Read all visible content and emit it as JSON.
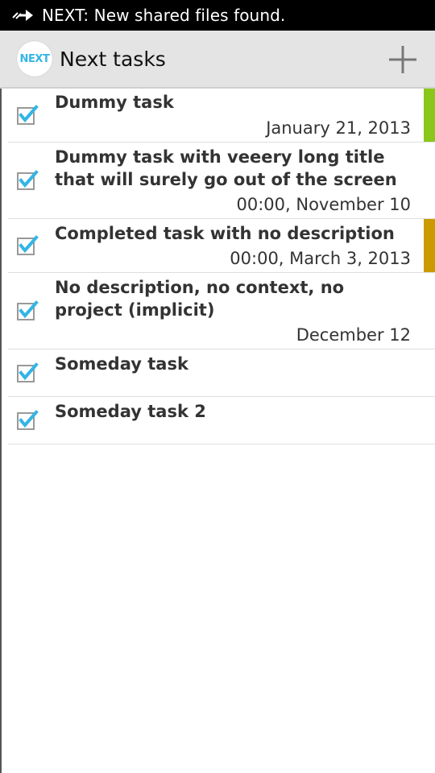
{
  "status_bar": {
    "notification_icon": "forward-arrow-icon",
    "text": "NEXT: New shared files found."
  },
  "action_bar": {
    "logo_text": "NEXT",
    "title": "Next tasks",
    "add_icon": "plus-icon"
  },
  "tasks": [
    {
      "title": "Dummy task",
      "date": "January 21, 2013",
      "checked": true,
      "context_color": "#8ac71a"
    },
    {
      "title": "Dummy task with veeery long title that will surely go out of the screen",
      "date": "00:00, November 10",
      "checked": true,
      "context_color": ""
    },
    {
      "title": "Completed task with no description",
      "date": "00:00, March 3, 2013",
      "checked": true,
      "context_color": "#cc9900"
    },
    {
      "title": "No description, no context, no project (implicit)",
      "date": "December 12",
      "checked": true,
      "context_color": ""
    },
    {
      "title": "Someday task",
      "date": "",
      "checked": true,
      "context_color": ""
    },
    {
      "title": "Someday task 2",
      "date": "",
      "checked": true,
      "context_color": ""
    }
  ],
  "colors": {
    "check_accent": "#33b5e5",
    "action_bar_bg": "#e4e4e4"
  }
}
